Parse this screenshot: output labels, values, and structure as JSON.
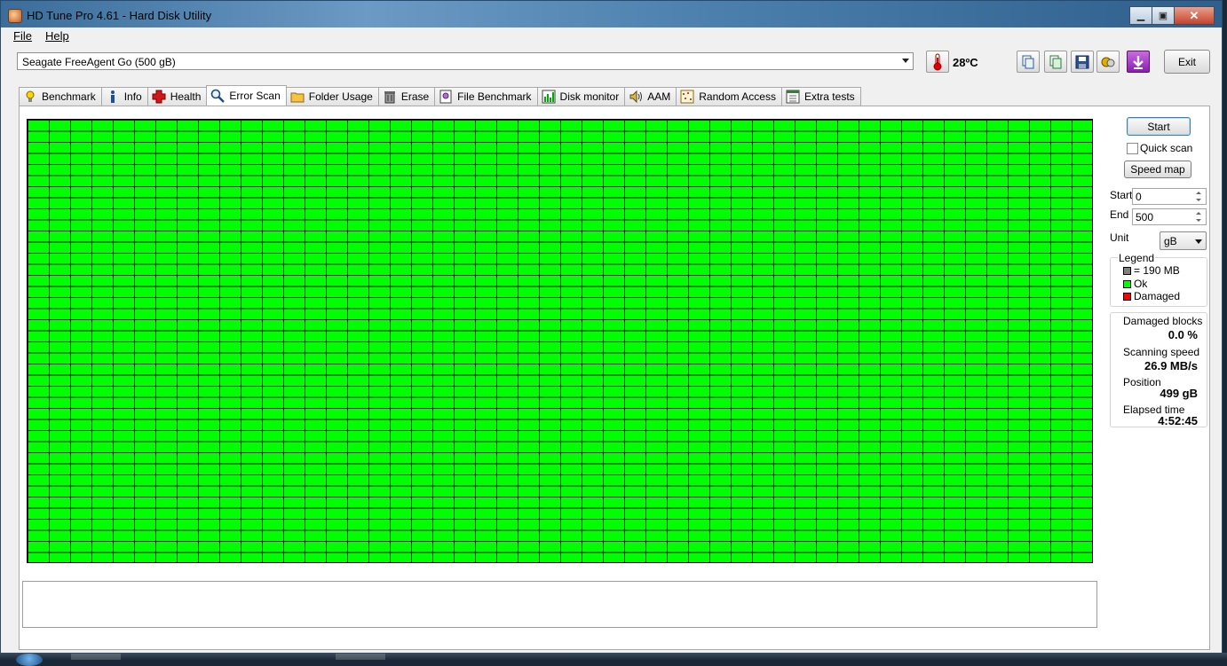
{
  "window": {
    "title": "HD Tune Pro 4.61 - Hard Disk Utility",
    "minimize": "▁",
    "maximize": "▣",
    "close": "✕"
  },
  "menu": {
    "file": "File",
    "help": "Help"
  },
  "toolbar": {
    "drive": "Seagate FreeAgent Go    (500 gB)",
    "temperature": "28ºC",
    "exit_label": "Exit"
  },
  "tabs": [
    {
      "label": "Benchmark",
      "icon": "benchmark-icon"
    },
    {
      "label": "Info",
      "icon": "info-icon"
    },
    {
      "label": "Health",
      "icon": "health-icon"
    },
    {
      "label": "Error Scan",
      "icon": "error-scan-icon",
      "active": true
    },
    {
      "label": "Folder Usage",
      "icon": "folder-usage-icon"
    },
    {
      "label": "Erase",
      "icon": "erase-icon"
    },
    {
      "label": "File Benchmark",
      "icon": "file-benchmark-icon"
    },
    {
      "label": "Disk monitor",
      "icon": "disk-monitor-icon"
    },
    {
      "label": "AAM",
      "icon": "aam-icon"
    },
    {
      "label": "Random Access",
      "icon": "random-access-icon"
    },
    {
      "label": "Extra tests",
      "icon": "extra-tests-icon"
    }
  ],
  "error_scan": {
    "start_button": "Start",
    "quick_scan_label": "Quick scan",
    "quick_scan_checked": false,
    "speed_map_button": "Speed map",
    "start_label": "Start",
    "start_value": "0",
    "end_label": "End",
    "end_value": "500",
    "unit_label": "Unit",
    "unit_value": "gB",
    "legend": {
      "title": "Legend",
      "block_size": "= 190 MB",
      "ok": "Ok",
      "damaged": "Damaged"
    },
    "stats": {
      "damaged_blocks_label": "Damaged blocks",
      "damaged_blocks_value": "0.0 %",
      "scanning_speed_label": "Scanning speed",
      "scanning_speed_value": "26.9 MB/s",
      "position_label": "Position",
      "position_value": "499 gB",
      "elapsed_label": "Elapsed time",
      "elapsed_value": "4:52:45"
    },
    "colors": {
      "ok": "#00ff00",
      "damaged": "#ff0000",
      "block": "#808080"
    }
  }
}
